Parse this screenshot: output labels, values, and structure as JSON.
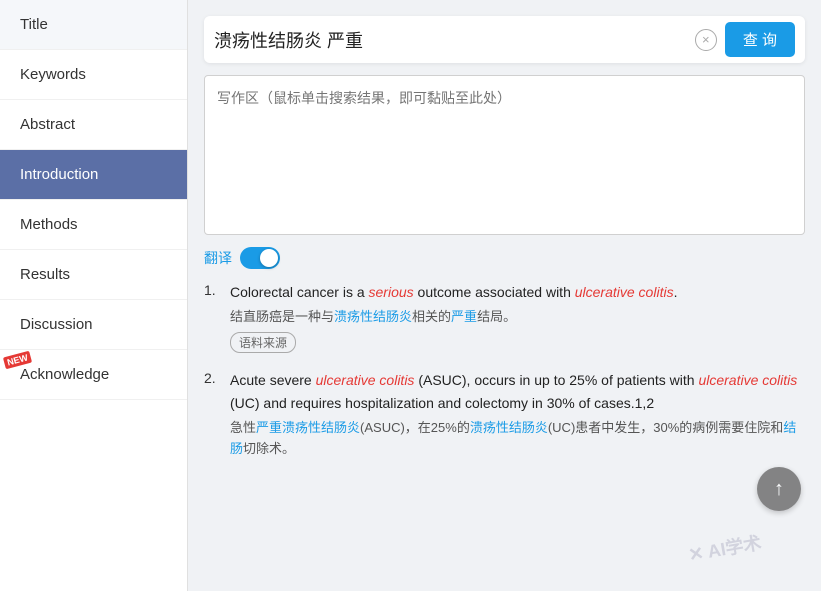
{
  "sidebar": {
    "items": [
      {
        "id": "title",
        "label": "Title",
        "active": false,
        "new": false
      },
      {
        "id": "keywords",
        "label": "Keywords",
        "active": false,
        "new": false
      },
      {
        "id": "abstract",
        "label": "Abstract",
        "active": false,
        "new": false
      },
      {
        "id": "introduction",
        "label": "Introduction",
        "active": true,
        "new": false
      },
      {
        "id": "methods",
        "label": "Methods",
        "active": false,
        "new": false
      },
      {
        "id": "results",
        "label": "Results",
        "active": false,
        "new": false
      },
      {
        "id": "discussion",
        "label": "Discussion",
        "active": false,
        "new": false
      },
      {
        "id": "acknowledge",
        "label": "Acknowledge",
        "active": false,
        "new": true
      }
    ]
  },
  "search": {
    "value": "溃疡性结肠炎 严重",
    "placeholder": "写作区（鼠标单击搜索结果，即可黏贴至此处）",
    "clear_title": "×",
    "query_label": "查 询"
  },
  "translate": {
    "label": "翻译"
  },
  "results": [
    {
      "num": "1.",
      "en_parts": [
        {
          "text": "Colorectal cancer is a ",
          "type": "normal"
        },
        {
          "text": "serious",
          "type": "red-italic"
        },
        {
          "text": " outcome associated with ",
          "type": "normal"
        },
        {
          "text": "ulcerative colitis",
          "type": "red-italic"
        },
        {
          "text": ".",
          "type": "normal"
        }
      ],
      "zh_parts": [
        {
          "text": "结直肠癌是一种与",
          "type": "normal"
        },
        {
          "text": "溃疡性结肠炎",
          "type": "blue"
        },
        {
          "text": "相关的",
          "type": "normal"
        },
        {
          "text": "严重",
          "type": "blue"
        },
        {
          "text": "结局。",
          "type": "normal"
        }
      ],
      "source_tag": "语料来源"
    },
    {
      "num": "2.",
      "en_parts": [
        {
          "text": "Acute severe ",
          "type": "normal"
        },
        {
          "text": "ulcerative colitis",
          "type": "red-italic"
        },
        {
          "text": " (ASUC), occurs in up to 25% of patients with ",
          "type": "normal"
        },
        {
          "text": "ulcerative colitis",
          "type": "red-italic"
        },
        {
          "text": " (UC) and requires hospitalization and colectomy in 30% of cases.1,2",
          "type": "normal"
        }
      ],
      "zh_parts": [
        {
          "text": "急性",
          "type": "normal"
        },
        {
          "text": "严重溃疡性结肠炎",
          "type": "blue"
        },
        {
          "text": "(ASUC)，在25%的",
          "type": "normal"
        },
        {
          "text": "溃疡性结肠炎",
          "type": "blue"
        },
        {
          "text": "(UC)患者中发生，30%的病例需要住院和",
          "type": "normal"
        },
        {
          "text": "结肠",
          "type": "blue"
        },
        {
          "text": "切除术。",
          "type": "normal"
        }
      ],
      "source_tag": null
    }
  ],
  "watermark": "✕ AI学术",
  "new_badge_label": "NEW",
  "scroll_up_icon": "↑"
}
